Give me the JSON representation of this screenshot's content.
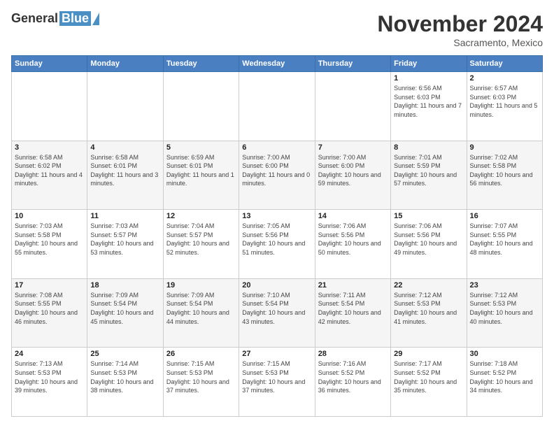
{
  "header": {
    "logo_general": "General",
    "logo_blue": "Blue",
    "month_title": "November 2024",
    "subtitle": "Sacramento, Mexico"
  },
  "days_of_week": [
    "Sunday",
    "Monday",
    "Tuesday",
    "Wednesday",
    "Thursday",
    "Friday",
    "Saturday"
  ],
  "weeks": [
    [
      {
        "day": "",
        "info": ""
      },
      {
        "day": "",
        "info": ""
      },
      {
        "day": "",
        "info": ""
      },
      {
        "day": "",
        "info": ""
      },
      {
        "day": "",
        "info": ""
      },
      {
        "day": "1",
        "info": "Sunrise: 6:56 AM\nSunset: 6:03 PM\nDaylight: 11 hours and 7 minutes."
      },
      {
        "day": "2",
        "info": "Sunrise: 6:57 AM\nSunset: 6:03 PM\nDaylight: 11 hours and 5 minutes."
      }
    ],
    [
      {
        "day": "3",
        "info": "Sunrise: 6:58 AM\nSunset: 6:02 PM\nDaylight: 11 hours and 4 minutes."
      },
      {
        "day": "4",
        "info": "Sunrise: 6:58 AM\nSunset: 6:01 PM\nDaylight: 11 hours and 3 minutes."
      },
      {
        "day": "5",
        "info": "Sunrise: 6:59 AM\nSunset: 6:01 PM\nDaylight: 11 hours and 1 minute."
      },
      {
        "day": "6",
        "info": "Sunrise: 7:00 AM\nSunset: 6:00 PM\nDaylight: 11 hours and 0 minutes."
      },
      {
        "day": "7",
        "info": "Sunrise: 7:00 AM\nSunset: 6:00 PM\nDaylight: 10 hours and 59 minutes."
      },
      {
        "day": "8",
        "info": "Sunrise: 7:01 AM\nSunset: 5:59 PM\nDaylight: 10 hours and 57 minutes."
      },
      {
        "day": "9",
        "info": "Sunrise: 7:02 AM\nSunset: 5:58 PM\nDaylight: 10 hours and 56 minutes."
      }
    ],
    [
      {
        "day": "10",
        "info": "Sunrise: 7:03 AM\nSunset: 5:58 PM\nDaylight: 10 hours and 55 minutes."
      },
      {
        "day": "11",
        "info": "Sunrise: 7:03 AM\nSunset: 5:57 PM\nDaylight: 10 hours and 53 minutes."
      },
      {
        "day": "12",
        "info": "Sunrise: 7:04 AM\nSunset: 5:57 PM\nDaylight: 10 hours and 52 minutes."
      },
      {
        "day": "13",
        "info": "Sunrise: 7:05 AM\nSunset: 5:56 PM\nDaylight: 10 hours and 51 minutes."
      },
      {
        "day": "14",
        "info": "Sunrise: 7:06 AM\nSunset: 5:56 PM\nDaylight: 10 hours and 50 minutes."
      },
      {
        "day": "15",
        "info": "Sunrise: 7:06 AM\nSunset: 5:56 PM\nDaylight: 10 hours and 49 minutes."
      },
      {
        "day": "16",
        "info": "Sunrise: 7:07 AM\nSunset: 5:55 PM\nDaylight: 10 hours and 48 minutes."
      }
    ],
    [
      {
        "day": "17",
        "info": "Sunrise: 7:08 AM\nSunset: 5:55 PM\nDaylight: 10 hours and 46 minutes."
      },
      {
        "day": "18",
        "info": "Sunrise: 7:09 AM\nSunset: 5:54 PM\nDaylight: 10 hours and 45 minutes."
      },
      {
        "day": "19",
        "info": "Sunrise: 7:09 AM\nSunset: 5:54 PM\nDaylight: 10 hours and 44 minutes."
      },
      {
        "day": "20",
        "info": "Sunrise: 7:10 AM\nSunset: 5:54 PM\nDaylight: 10 hours and 43 minutes."
      },
      {
        "day": "21",
        "info": "Sunrise: 7:11 AM\nSunset: 5:54 PM\nDaylight: 10 hours and 42 minutes."
      },
      {
        "day": "22",
        "info": "Sunrise: 7:12 AM\nSunset: 5:53 PM\nDaylight: 10 hours and 41 minutes."
      },
      {
        "day": "23",
        "info": "Sunrise: 7:12 AM\nSunset: 5:53 PM\nDaylight: 10 hours and 40 minutes."
      }
    ],
    [
      {
        "day": "24",
        "info": "Sunrise: 7:13 AM\nSunset: 5:53 PM\nDaylight: 10 hours and 39 minutes."
      },
      {
        "day": "25",
        "info": "Sunrise: 7:14 AM\nSunset: 5:53 PM\nDaylight: 10 hours and 38 minutes."
      },
      {
        "day": "26",
        "info": "Sunrise: 7:15 AM\nSunset: 5:53 PM\nDaylight: 10 hours and 37 minutes."
      },
      {
        "day": "27",
        "info": "Sunrise: 7:15 AM\nSunset: 5:53 PM\nDaylight: 10 hours and 37 minutes."
      },
      {
        "day": "28",
        "info": "Sunrise: 7:16 AM\nSunset: 5:52 PM\nDaylight: 10 hours and 36 minutes."
      },
      {
        "day": "29",
        "info": "Sunrise: 7:17 AM\nSunset: 5:52 PM\nDaylight: 10 hours and 35 minutes."
      },
      {
        "day": "30",
        "info": "Sunrise: 7:18 AM\nSunset: 5:52 PM\nDaylight: 10 hours and 34 minutes."
      }
    ]
  ]
}
